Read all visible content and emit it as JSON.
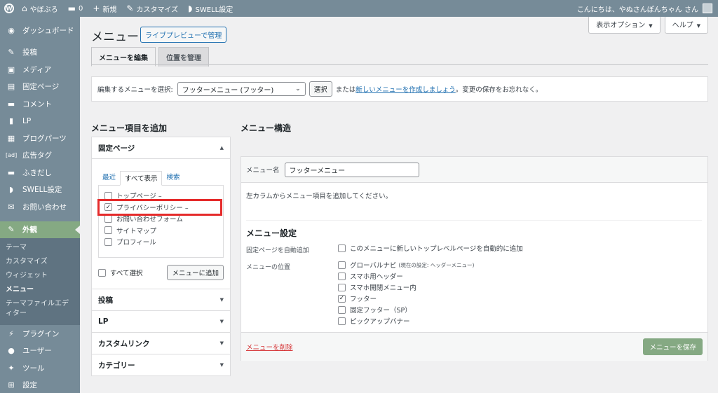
{
  "adminbar": {
    "site_name": "やぼぶろ",
    "comments_count": "0",
    "new_label": "新規",
    "customize_label": "カスタマイズ",
    "swell_label": "SWELL設定",
    "greeting": "こんにちは、やぬさんぽんちゃん さん"
  },
  "sidebar": {
    "items": [
      {
        "icon": "dashboard-icon",
        "glyph": "◉",
        "label": "ダッシュボード"
      },
      {
        "icon": "pin-icon",
        "glyph": "✎",
        "label": "投稿"
      },
      {
        "icon": "media-icon",
        "glyph": "▣",
        "label": "メディア"
      },
      {
        "icon": "page-icon",
        "glyph": "▤",
        "label": "固定ページ"
      },
      {
        "icon": "comment-icon",
        "glyph": "▬",
        "label": "コメント"
      },
      {
        "icon": "lp-icon",
        "glyph": "▮",
        "label": "LP"
      },
      {
        "icon": "blog-parts-icon",
        "glyph": "▦",
        "label": "ブログパーツ"
      },
      {
        "icon": "ad-icon",
        "glyph": "[ad]",
        "label": "広告タグ"
      },
      {
        "icon": "balloon-icon",
        "glyph": "▬",
        "label": "ふきだし"
      },
      {
        "icon": "swell-icon",
        "glyph": "◗",
        "label": "SWELL設定"
      },
      {
        "icon": "mail-icon",
        "glyph": "✉",
        "label": "お問い合わせ"
      }
    ],
    "appearance": {
      "icon": "brush-icon",
      "glyph": "✎",
      "label": "外観"
    },
    "submenu": [
      "テーマ",
      "カスタマイズ",
      "ウィジェット",
      "メニュー",
      "テーマファイルエディター"
    ],
    "bottom_items": [
      {
        "icon": "plugin-icon",
        "glyph": "⚡",
        "label": "プラグイン"
      },
      {
        "icon": "user-icon",
        "glyph": "●",
        "label": "ユーザー"
      },
      {
        "icon": "tool-icon",
        "glyph": "✦",
        "label": "ツール"
      },
      {
        "icon": "settings-icon",
        "glyph": "⊞",
        "label": "設定"
      }
    ]
  },
  "screen_meta": {
    "options": "表示オプション",
    "help": "ヘルプ"
  },
  "page": {
    "title": "メニュー",
    "preview_button": "ライブプレビューで管理",
    "tabs": [
      "メニューを編集",
      "位置を管理"
    ]
  },
  "select_bar": {
    "label": "編集するメニューを選択:",
    "selected": "フッターメニュー (フッター)",
    "select_button": "選択",
    "or_text": "または",
    "new_link": "新しいメニューを作成しましょう",
    "suffix": "。変更の保存をお忘れなく。"
  },
  "add_items": {
    "heading": "メニュー項目を追加",
    "panel_title": "固定ページ",
    "mini_tabs": [
      "最近",
      "すべて表示",
      "検索"
    ],
    "pages": [
      {
        "label": "トップページ –",
        "checked": false
      },
      {
        "label": "プライバシーポリシー –",
        "checked": true
      },
      {
        "label": "お問い合わせフォーム",
        "checked": false
      },
      {
        "label": "サイトマップ",
        "checked": false
      },
      {
        "label": "プロフィール",
        "checked": false
      }
    ],
    "select_all": "すべて選択",
    "add_button": "メニューに追加",
    "other_panels": [
      "投稿",
      "LP",
      "カスタムリンク",
      "カテゴリー"
    ]
  },
  "structure": {
    "heading": "メニュー構造",
    "name_label": "メニュー名",
    "name_value": "フッターメニュー",
    "hint": "左カラムからメニュー項目を追加してください。",
    "settings_heading": "メニュー設定",
    "auto_add_label": "固定ページを自動追加",
    "auto_add_option": "このメニューに新しいトップレベルページを自動的に追加",
    "location_label": "メニューの位置",
    "locations": [
      {
        "label": "グローバルナビ",
        "note": "(現在の設定: ヘッダーメニュー)",
        "checked": false
      },
      {
        "label": "スマホ用ヘッダー",
        "note": "",
        "checked": false
      },
      {
        "label": "スマホ開閉メニュー内",
        "note": "",
        "checked": false
      },
      {
        "label": "フッター",
        "note": "",
        "checked": true
      },
      {
        "label": "固定フッター（SP）",
        "note": "",
        "checked": false
      },
      {
        "label": "ピックアップバナー",
        "note": "",
        "checked": false
      }
    ],
    "delete_link": "メニューを削除",
    "save_button": "メニューを保存"
  },
  "colors": {
    "sidebar": "#768b98",
    "accent": "#85a983",
    "link": "#2271b1",
    "highlight": "#e52b2b"
  }
}
